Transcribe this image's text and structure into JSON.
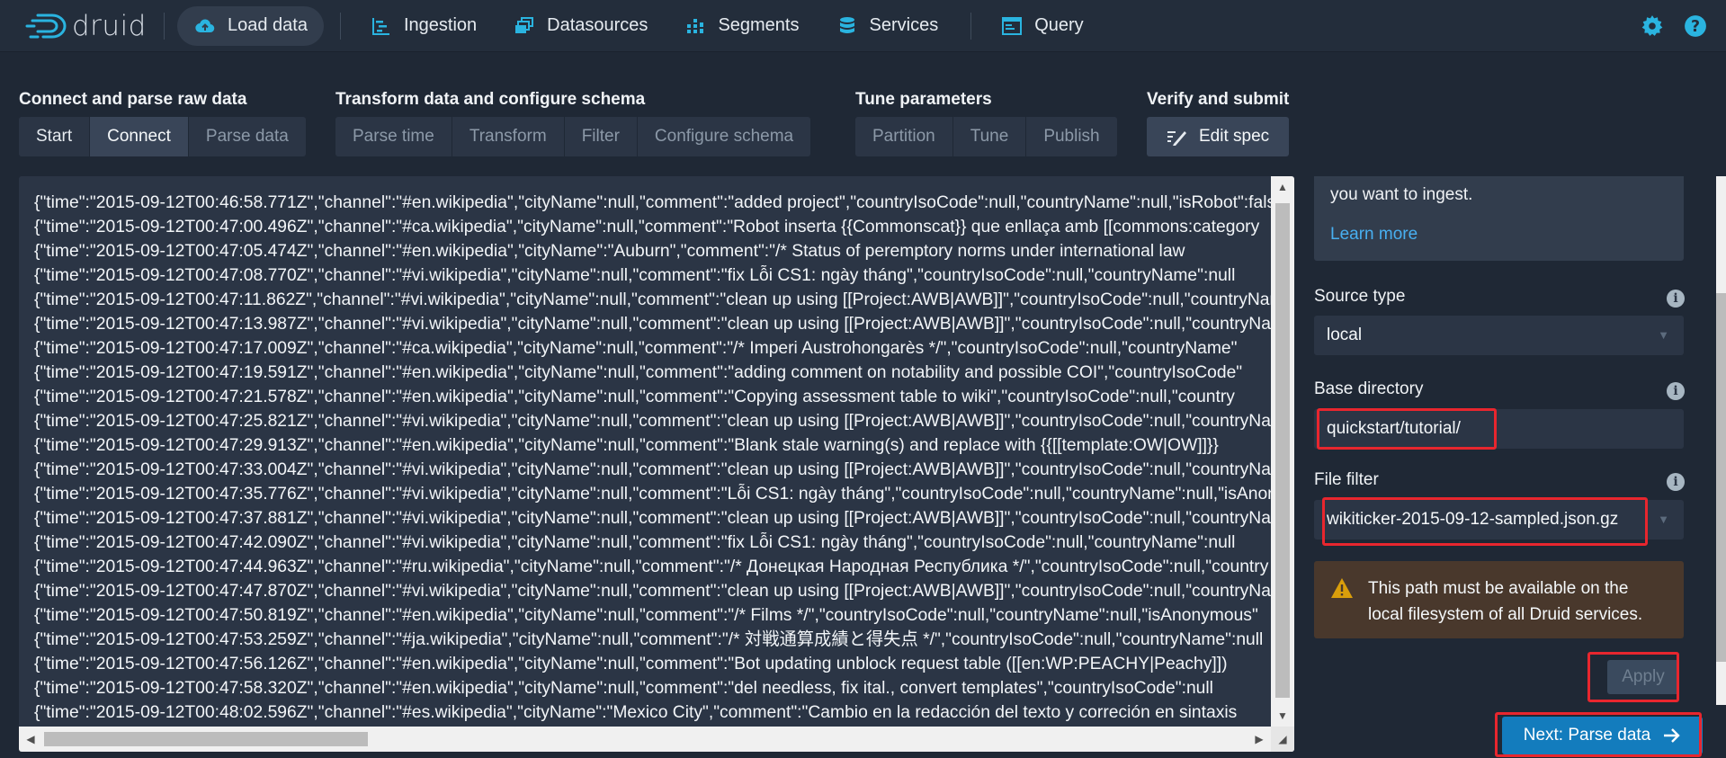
{
  "brand": {
    "name": "druid"
  },
  "nav": {
    "items": [
      {
        "label": "Load data",
        "icon": "cloud-upload-icon",
        "active": true
      },
      {
        "label": "Ingestion",
        "icon": "gantt-chart-icon"
      },
      {
        "label": "Datasources",
        "icon": "multi-select-icon"
      },
      {
        "label": "Segments",
        "icon": "stacked-chart-icon"
      },
      {
        "label": "Services",
        "icon": "database-icon"
      },
      {
        "label": "Query",
        "icon": "application-icon"
      }
    ],
    "settings_icon": "gear-icon",
    "help_icon": "help-icon"
  },
  "steps": [
    {
      "title": "Connect and parse raw data",
      "tabs": [
        "Start",
        "Connect",
        "Parse data"
      ]
    },
    {
      "title": "Transform data and configure schema",
      "tabs": [
        "Parse time",
        "Transform",
        "Filter",
        "Configure schema"
      ]
    },
    {
      "title": "Tune parameters",
      "tabs": [
        "Partition",
        "Tune",
        "Publish"
      ]
    },
    {
      "title": "Verify and submit",
      "tabs": [
        "Edit spec"
      ]
    }
  ],
  "raw_data": {
    "lines": [
      "{\"time\":\"2015-09-12T00:46:58.771Z\",\"channel\":\"#en.wikipedia\",\"cityName\":null,\"comment\":\"added project\",\"countryIsoCode\":null,\"countryName\":null,\"isRobot\":false",
      "{\"time\":\"2015-09-12T00:47:00.496Z\",\"channel\":\"#ca.wikipedia\",\"cityName\":null,\"comment\":\"Robot inserta {{Commonscat}} que enllaça amb [[commons:category",
      "{\"time\":\"2015-09-12T00:47:05.474Z\",\"channel\":\"#en.wikipedia\",\"cityName\":\"Auburn\",\"comment\":\"/* Status of peremptory norms under international law",
      "{\"time\":\"2015-09-12T00:47:08.770Z\",\"channel\":\"#vi.wikipedia\",\"cityName\":null,\"comment\":\"fix Lỗi CS1: ngày tháng\",\"countryIsoCode\":null,\"countryName\":null",
      "{\"time\":\"2015-09-12T00:47:11.862Z\",\"channel\":\"#vi.wikipedia\",\"cityName\":null,\"comment\":\"clean up using [[Project:AWB|AWB]]\",\"countryIsoCode\":null,\"countryName\"",
      "{\"time\":\"2015-09-12T00:47:13.987Z\",\"channel\":\"#vi.wikipedia\",\"cityName\":null,\"comment\":\"clean up using [[Project:AWB|AWB]]\",\"countryIsoCode\":null,\"countryName\"",
      "{\"time\":\"2015-09-12T00:47:17.009Z\",\"channel\":\"#ca.wikipedia\",\"cityName\":null,\"comment\":\"/* Imperi Austrohongarès */\",\"countryIsoCode\":null,\"countryName\"",
      "{\"time\":\"2015-09-12T00:47:19.591Z\",\"channel\":\"#en.wikipedia\",\"cityName\":null,\"comment\":\"adding comment on notability and possible COI\",\"countryIsoCode\"",
      "{\"time\":\"2015-09-12T00:47:21.578Z\",\"channel\":\"#en.wikipedia\",\"cityName\":null,\"comment\":\"Copying assessment table to wiki\",\"countryIsoCode\":null,\"country",
      "{\"time\":\"2015-09-12T00:47:25.821Z\",\"channel\":\"#vi.wikipedia\",\"cityName\":null,\"comment\":\"clean up using [[Project:AWB|AWB]]\",\"countryIsoCode\":null,\"countryName\"",
      "{\"time\":\"2015-09-12T00:47:29.913Z\",\"channel\":\"#en.wikipedia\",\"cityName\":null,\"comment\":\"Blank stale warning(s) and replace with {{[[template:OW|OW]]}}",
      "{\"time\":\"2015-09-12T00:47:33.004Z\",\"channel\":\"#vi.wikipedia\",\"cityName\":null,\"comment\":\"clean up using [[Project:AWB|AWB]]\",\"countryIsoCode\":null,\"countryName\"",
      "{\"time\":\"2015-09-12T00:47:35.776Z\",\"channel\":\"#vi.wikipedia\",\"cityName\":null,\"comment\":\"Lỗi CS1: ngày tháng\",\"countryIsoCode\":null,\"countryName\":null,\"isAnon\"",
      "{\"time\":\"2015-09-12T00:47:37.881Z\",\"channel\":\"#vi.wikipedia\",\"cityName\":null,\"comment\":\"clean up using [[Project:AWB|AWB]]\",\"countryIsoCode\":null,\"countryName\"",
      "{\"time\":\"2015-09-12T00:47:42.090Z\",\"channel\":\"#vi.wikipedia\",\"cityName\":null,\"comment\":\"fix Lỗi CS1: ngày tháng\",\"countryIsoCode\":null,\"countryName\":null",
      "{\"time\":\"2015-09-12T00:47:44.963Z\",\"channel\":\"#ru.wikipedia\",\"cityName\":null,\"comment\":\"/* Донецкая Народная Республика */\",\"countryIsoCode\":null,\"country",
      "{\"time\":\"2015-09-12T00:47:47.870Z\",\"channel\":\"#vi.wikipedia\",\"cityName\":null,\"comment\":\"clean up using [[Project:AWB|AWB]]\",\"countryIsoCode\":null,\"countryName\"",
      "{\"time\":\"2015-09-12T00:47:50.819Z\",\"channel\":\"#en.wikipedia\",\"cityName\":null,\"comment\":\"/* Films */\",\"countryIsoCode\":null,\"countryName\":null,\"isAnonymous\"",
      "{\"time\":\"2015-09-12T00:47:53.259Z\",\"channel\":\"#ja.wikipedia\",\"cityName\":null,\"comment\":\"/* 対戦通算成績と得失点 */\",\"countryIsoCode\":null,\"countryName\":null",
      "{\"time\":\"2015-09-12T00:47:56.126Z\",\"channel\":\"#en.wikipedia\",\"cityName\":null,\"comment\":\"Bot updating unblock request table ([[en:WP:PEACHY|Peachy]])",
      "{\"time\":\"2015-09-12T00:47:58.320Z\",\"channel\":\"#en.wikipedia\",\"cityName\":null,\"comment\":\"del needless, fix ital., convert templates\",\"countryIsoCode\":null",
      "{\"time\":\"2015-09-12T00:48:02.596Z\",\"channel\":\"#es.wikipedia\",\"cityName\":\"Mexico City\",\"comment\":\"Cambio en la redacción del texto y correción en sintaxis"
    ]
  },
  "form": {
    "info_text": "you want to ingest.",
    "learn_more": "Learn more",
    "source_type": {
      "label": "Source type",
      "value": "local"
    },
    "base_directory": {
      "label": "Base directory",
      "value": "quickstart/tutorial/"
    },
    "file_filter": {
      "label": "File filter",
      "value": "wikiticker-2015-09-12-sampled.json.gz"
    },
    "warning": "This path must be available on the local filesystem of all Druid services.",
    "apply_label": "Apply",
    "next_label": "Next: Parse data"
  },
  "colors": {
    "background": "#1f2835",
    "panel": "#2b3545",
    "primary": "#137cbd",
    "link": "#48aff0",
    "warning_bg": "#49382c",
    "highlight": "#e8262e"
  }
}
